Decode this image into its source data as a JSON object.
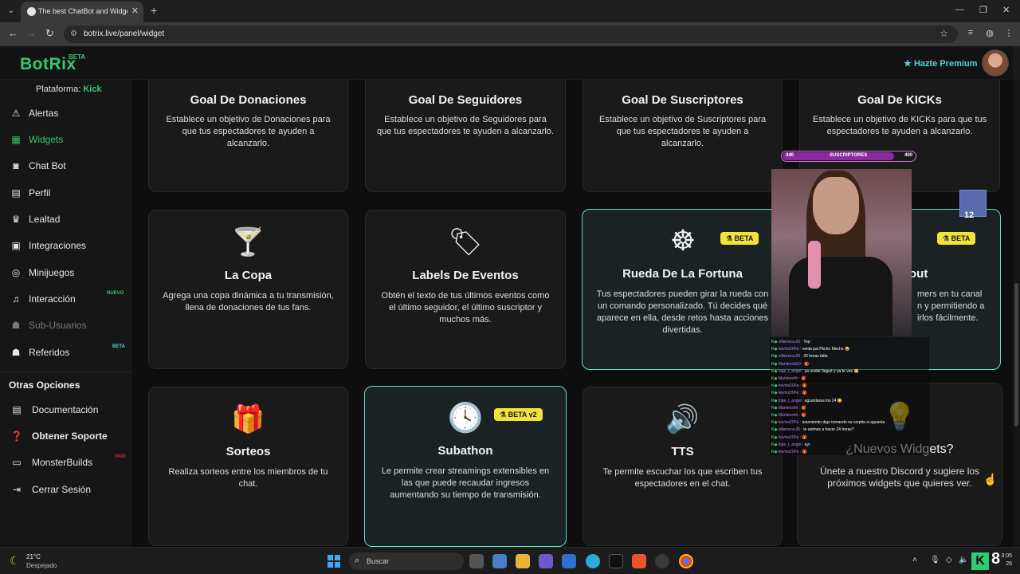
{
  "browser": {
    "tab_title": "The best ChatBot and Widgets",
    "url_text": "botrix.live/panel/widget"
  },
  "header": {
    "logo": "BotRix",
    "logo_beta": "BETA",
    "premium_label": "Hazte Premium"
  },
  "sidebar": {
    "platform_label": "Plataforma:",
    "platform_value": "Kick",
    "items": [
      {
        "label": "Alertas",
        "icon": "warning-icon"
      },
      {
        "label": "Widgets",
        "icon": "grid-icon"
      },
      {
        "label": "Chat Bot",
        "icon": "robot-icon"
      },
      {
        "label": "Perfil",
        "icon": "profile-card-icon"
      },
      {
        "label": "Lealtad",
        "icon": "trophy-icon"
      },
      {
        "label": "Integraciones",
        "icon": "integration-icon"
      },
      {
        "label": "Minijuegos",
        "icon": "gamepad-icon"
      },
      {
        "label": "Interacción",
        "icon": "music-icon",
        "badge": "NUEVO"
      },
      {
        "label": "Sub-Usuarios",
        "icon": "users-icon"
      },
      {
        "label": "Referidos",
        "icon": "referral-icon",
        "badge": "BETA"
      }
    ],
    "other_title": "Otras Opciones",
    "other_items": [
      {
        "label": "Documentación",
        "icon": "book-icon"
      },
      {
        "label": "Obtener Soporte",
        "icon": "help-icon"
      },
      {
        "label": "MonsterBuilds",
        "icon": "monitor-icon",
        "badge": "PAID"
      },
      {
        "label": "Cerrar Sesión",
        "icon": "logout-icon"
      }
    ]
  },
  "cards": [
    {
      "title": "Goal De Donaciones",
      "desc": "Establece un objetivo de Donaciones para que tus espectadores te ayuden a alcanzarlo."
    },
    {
      "title": "Goal De Seguidores",
      "desc": "Establece un objetivo de Seguidores para que tus espectadores te ayuden a alcanzarlo."
    },
    {
      "title": "Goal De Suscriptores",
      "desc": "Establece un objetivo de Suscriptores para que tus espectadores te ayuden a alcanzarlo."
    },
    {
      "title": "Goal De KICKs",
      "desc": "Establece un objetivo de KICKs para que tus espectadores te ayuden a alcanzarlo."
    },
    {
      "title": "La Copa",
      "desc": "Agrega una copa dinámica a tu transmisión, llena de donaciones de tus fans.",
      "icon": "cocktail-icon"
    },
    {
      "title": "Labels De Eventos",
      "desc": "Obtén el texto de tus últimos eventos como el último seguidor, el último suscriptor y muchos más.",
      "icon": "tags-icon"
    },
    {
      "title": "Rueda De La Fortuna",
      "desc": "Tus espectadores pueden girar la rueda con un comando personalizado. Tú decides qué aparece en ella, desde retos hasta acciones divertidas.",
      "badge": "BETA",
      "icon": "wheel-icon"
    },
    {
      "title": "out",
      "desc_lines": [
        "mers en tu canal",
        "n y permitiendo a",
        "irlos fácilmente."
      ],
      "badge": "BETA"
    },
    {
      "title": "Sorteos",
      "desc": "Realiza sorteos entre los miembros de tu chat.",
      "icon": "gifts-icon"
    },
    {
      "title": "Subathon",
      "desc": "Le permite crear streamings extensibles en las que puede recaudar ingresos aumentando su tiempo de transmisión.",
      "badge": "BETA v2",
      "icon": "clock-icon"
    },
    {
      "title": "TTS",
      "desc": "Te permite escuchar los que escriben tus espectadores en el chat.",
      "icon": "speaker-icon"
    },
    {
      "title": "¿Nuevos Widgets?",
      "desc": "Únete a nuestro Discord y sugiere los próximos widgets que quieres ver.",
      "icon": "lightbulb-icon"
    }
  ],
  "overlay": {
    "sub_start": "340",
    "sub_label": "SUSCRIPTORES",
    "sub_goal": "400",
    "mini_num": "12",
    "chat": [
      {
        "user": "villarreca‹26 :",
        "msg": "Yep"
      },
      {
        "user": "kevinx20Fe :",
        "msg": "venta pal Pkcho Mecho 😂"
      },
      {
        "user": "villarreca‹26 :",
        "msg": "20 horas falta"
      },
      {
        "user": "MarilenshhD :",
        "msg": "🎁"
      },
      {
        "user": "lope_t_angel :",
        "msg": "ya recibir llegué y ya te veo 😊"
      },
      {
        "user": "Marilenshh :",
        "msg": "🎁"
      },
      {
        "user": "kevinx20Fe :",
        "msg": "🎁"
      },
      {
        "user": "kevinx20Fe :",
        "msg": "🎁"
      },
      {
        "user": "lope_t_angel :",
        "msg": "aguantaras los 24 😊"
      },
      {
        "user": "Marilenshh :",
        "msg": "🎁"
      },
      {
        "user": "Marilenshh :",
        "msg": "🎁"
      },
      {
        "user": "kevinx20Fe :",
        "msg": "asumiendo digo tomando su corpita si aguanta"
      },
      {
        "user": "villarreca‹26 :",
        "msg": "te animas a hacer 24 horas?"
      },
      {
        "user": "kevinx20Fe :",
        "msg": "🎁"
      },
      {
        "user": "lope_t_angel :",
        "msg": "ayi"
      },
      {
        "user": "kevinx20Fe :",
        "msg": "🎁"
      }
    ]
  },
  "taskbar": {
    "temp": "21°C",
    "weather": "Despejado",
    "search": "Buscar",
    "kick_num": "8",
    "time": "3:05",
    "date": "26"
  }
}
